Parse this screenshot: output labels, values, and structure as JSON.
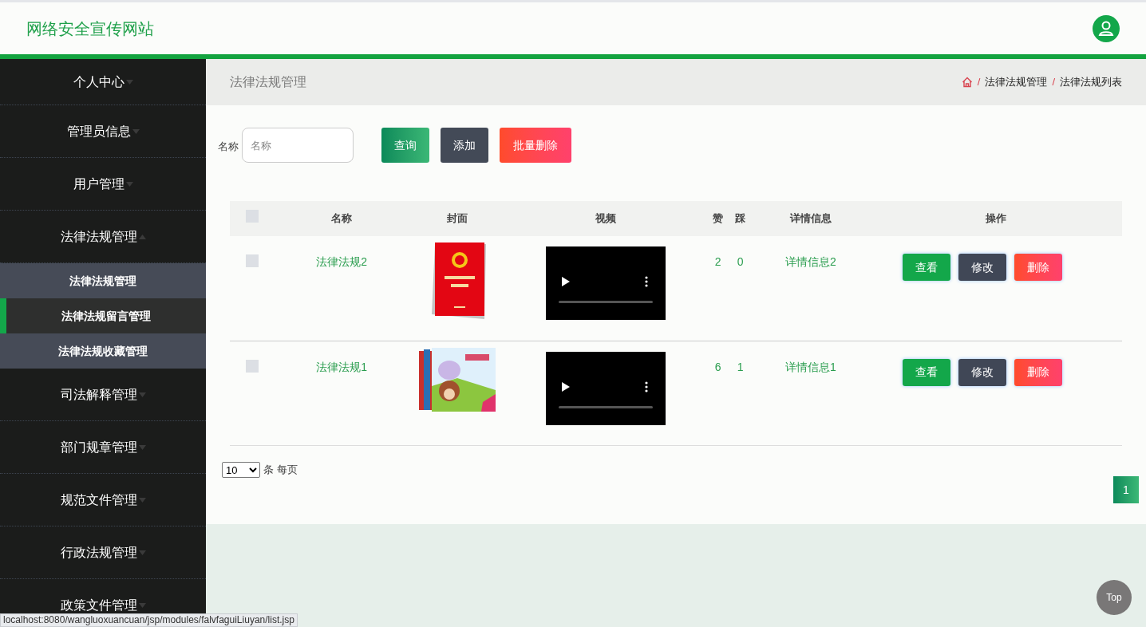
{
  "site": {
    "title": "网络安全宣传网站"
  },
  "sidebar": {
    "items": [
      {
        "label": "个人中心",
        "expanded": false
      },
      {
        "label": "管理员信息",
        "expanded": false
      },
      {
        "label": "用户管理",
        "expanded": false
      },
      {
        "label": "法律法规管理",
        "expanded": true,
        "children": [
          {
            "label": "法律法规管理",
            "selected": false
          },
          {
            "label": "法律法规留言管理",
            "selected": true
          },
          {
            "label": "法律法规收藏管理",
            "selected": false
          }
        ]
      },
      {
        "label": "司法解释管理",
        "expanded": false
      },
      {
        "label": "部门规章管理",
        "expanded": false
      },
      {
        "label": "规范文件管理",
        "expanded": false
      },
      {
        "label": "行政法规管理",
        "expanded": false
      },
      {
        "label": "政策文件管理",
        "expanded": false
      }
    ]
  },
  "page_header": {
    "title": "法律法规管理",
    "breadcrumb": [
      "法律法规管理",
      "法律法规列表"
    ],
    "separator": "/"
  },
  "search": {
    "label": "名称",
    "placeholder": "名称",
    "buttons": [
      {
        "label": "查询",
        "kind": "primary"
      },
      {
        "label": "添加",
        "kind": "secondary"
      },
      {
        "label": "批量删除",
        "kind": "danger"
      }
    ]
  },
  "table": {
    "select_all": {
      "checked": false
    },
    "columns": [
      "名称",
      "封面",
      "视频",
      "赞",
      "踩",
      "详情信息",
      "操作"
    ],
    "rows": [
      {
        "checked": false,
        "name": "法律法规2",
        "likes": "2",
        "dislikes": "0",
        "detail": "详情信息2",
        "actions": [
          {
            "label": "查看",
            "kind": "view"
          },
          {
            "label": "修改",
            "kind": "edit"
          },
          {
            "label": "删除",
            "kind": "delete"
          }
        ]
      },
      {
        "checked": false,
        "name": "法律法规1",
        "likes": "6",
        "dislikes": "1",
        "detail": "详情信息1",
        "actions": [
          {
            "label": "查看",
            "kind": "view"
          },
          {
            "label": "修改",
            "kind": "edit"
          },
          {
            "label": "删除",
            "kind": "delete"
          }
        ]
      }
    ]
  },
  "pagination": {
    "page_size": "10",
    "per_page_label": "条 每页",
    "pages": [
      {
        "label": "1",
        "selected": true
      }
    ]
  },
  "back_to_top": "Top",
  "status_bar": "localhost:8080/wangluoxuancuan/jsp/modules/falvfaguiLiuyan/list.jsp"
}
